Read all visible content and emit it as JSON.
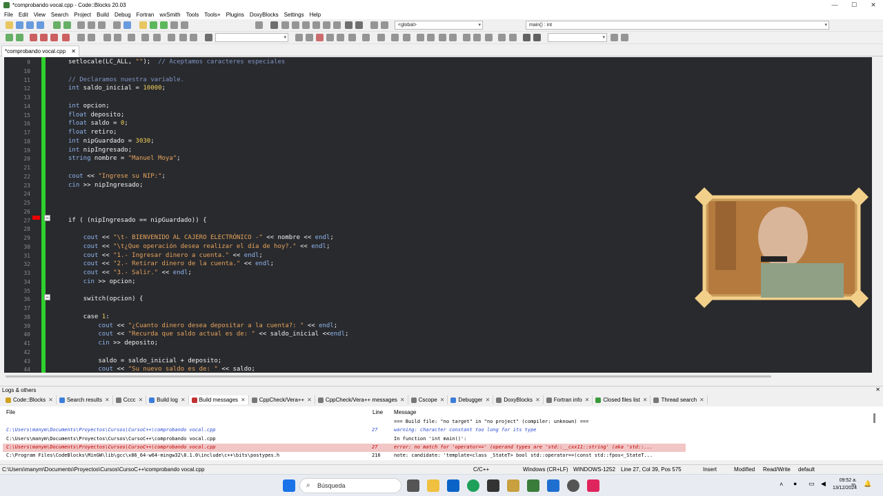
{
  "window": {
    "title": "*comprobando vocal.cpp - Code::Blocks 20.03",
    "controls": [
      "—",
      "☐",
      "✕"
    ]
  },
  "menu": [
    "File",
    "Edit",
    "View",
    "Search",
    "Project",
    "Build",
    "Debug",
    "Fortran",
    "wxSmith",
    "Tools",
    "Tools+",
    "Plugins",
    "DoxyBlocks",
    "Settings",
    "Help"
  ],
  "toolbar": {
    "scope_combo": "<global>",
    "function_combo": "main() : int"
  },
  "editor": {
    "tab_label": "*comprobando vocal.cpp",
    "tab_close": "✕",
    "fold_minus": "−",
    "lines": [
      {
        "n": "9",
        "t": [
          [
            "",
            "setlocale(LC_ALL, "
          ],
          [
            "str",
            "\"\""
          ],
          [
            "",
            ");  "
          ],
          [
            "com",
            "// Aceptamos caracteres especiales"
          ]
        ]
      },
      {
        "n": "10",
        "t": []
      },
      {
        "n": "11",
        "t": [
          [
            "com",
            "// Declaramos nuestra variable."
          ]
        ]
      },
      {
        "n": "12",
        "t": [
          [
            "type",
            "int"
          ],
          [
            "",
            " saldo_inicial = "
          ],
          [
            "num",
            "10000"
          ],
          [
            "",
            ";"
          ]
        ]
      },
      {
        "n": "13",
        "t": []
      },
      {
        "n": "14",
        "t": [
          [
            "type",
            "int"
          ],
          [
            "",
            " opcion;"
          ]
        ]
      },
      {
        "n": "15",
        "t": [
          [
            "type",
            "float"
          ],
          [
            "",
            " deposito;"
          ]
        ]
      },
      {
        "n": "16",
        "t": [
          [
            "type",
            "float"
          ],
          [
            "",
            " saldo = "
          ],
          [
            "num",
            "0"
          ],
          [
            "",
            ";"
          ]
        ]
      },
      {
        "n": "17",
        "t": [
          [
            "type",
            "float"
          ],
          [
            "",
            " retiro;"
          ]
        ]
      },
      {
        "n": "18",
        "t": [
          [
            "type",
            "int"
          ],
          [
            "",
            " nipGuardado = "
          ],
          [
            "num",
            "3030"
          ],
          [
            "",
            ";"
          ]
        ]
      },
      {
        "n": "19",
        "t": [
          [
            "type",
            "int"
          ],
          [
            "",
            " nipIngresado;"
          ]
        ]
      },
      {
        "n": "20",
        "t": [
          [
            "type",
            "string"
          ],
          [
            "",
            " nombre = "
          ],
          [
            "str",
            "\"Manuel Moya\""
          ],
          [
            "",
            ";"
          ]
        ]
      },
      {
        "n": "21",
        "t": []
      },
      {
        "n": "22",
        "t": [
          [
            "type",
            "cout"
          ],
          [
            "",
            " << "
          ],
          [
            "str",
            "\"Ingrese su NIP:\""
          ],
          [
            "",
            ";"
          ]
        ]
      },
      {
        "n": "23",
        "t": [
          [
            "type",
            "cin"
          ],
          [
            "",
            " >> nipIngresado;"
          ]
        ]
      },
      {
        "n": "24",
        "t": []
      },
      {
        "n": "25",
        "t": []
      },
      {
        "n": "26",
        "t": []
      },
      {
        "n": "27",
        "t": [
          [
            "",
            "if ( (nipIngresado == nipGuardado)) {"
          ]
        ]
      },
      {
        "n": "28",
        "t": []
      },
      {
        "n": "29",
        "t": [
          [
            "",
            "    "
          ],
          [
            "type",
            "cout"
          ],
          [
            "",
            " << "
          ],
          [
            "str",
            "\"\\t- BIENVENIDO AL CAJERO ELECTRÓNICO -\""
          ],
          [
            "",
            " << nombre << "
          ],
          [
            "type",
            "endl"
          ],
          [
            "",
            ";"
          ]
        ]
      },
      {
        "n": "30",
        "t": [
          [
            "",
            "    "
          ],
          [
            "type",
            "cout"
          ],
          [
            "",
            " << "
          ],
          [
            "str",
            "\"\\t¿Que operación desea realizar el día de hoy?.\""
          ],
          [
            "",
            " << "
          ],
          [
            "type",
            "endl"
          ],
          [
            "",
            ";"
          ]
        ]
      },
      {
        "n": "31",
        "t": [
          [
            "",
            "    "
          ],
          [
            "type",
            "cout"
          ],
          [
            "",
            " << "
          ],
          [
            "str",
            "\"1.- Ingresar dinero a cuenta.\""
          ],
          [
            "",
            " << "
          ],
          [
            "type",
            "endl"
          ],
          [
            "",
            ";"
          ]
        ]
      },
      {
        "n": "32",
        "t": [
          [
            "",
            "    "
          ],
          [
            "type",
            "cout"
          ],
          [
            "",
            " << "
          ],
          [
            "str",
            "\"2.- Retirar dinero de la cuenta.\""
          ],
          [
            "",
            " << "
          ],
          [
            "type",
            "endl"
          ],
          [
            "",
            ";"
          ]
        ]
      },
      {
        "n": "33",
        "t": [
          [
            "",
            "    "
          ],
          [
            "type",
            "cout"
          ],
          [
            "",
            " << "
          ],
          [
            "str",
            "\"3.- Salir.\""
          ],
          [
            "",
            " << "
          ],
          [
            "type",
            "endl"
          ],
          [
            "",
            ";"
          ]
        ]
      },
      {
        "n": "34",
        "t": [
          [
            "",
            "    "
          ],
          [
            "type",
            "cin"
          ],
          [
            "",
            " >> opcion;"
          ]
        ]
      },
      {
        "n": "35",
        "t": []
      },
      {
        "n": "36",
        "t": [
          [
            "",
            "    switch(opcion) {"
          ]
        ]
      },
      {
        "n": "37",
        "t": []
      },
      {
        "n": "38",
        "t": [
          [
            "",
            "    case "
          ],
          [
            "num",
            "1"
          ],
          [
            "",
            ":"
          ]
        ]
      },
      {
        "n": "39",
        "t": [
          [
            "",
            "        "
          ],
          [
            "type",
            "cout"
          ],
          [
            "",
            " << "
          ],
          [
            "str",
            "\"¿Cuanto dinero desea depositar a la cuenta?: \""
          ],
          [
            "",
            " << "
          ],
          [
            "type",
            "endl"
          ],
          [
            "",
            ";"
          ]
        ]
      },
      {
        "n": "40",
        "t": [
          [
            "",
            "        "
          ],
          [
            "type",
            "cout"
          ],
          [
            "",
            " << "
          ],
          [
            "str",
            "\"Recurda que saldo actual es de: \""
          ],
          [
            "",
            " << saldo_inicial <<"
          ],
          [
            "type",
            "endl"
          ],
          [
            "",
            ";"
          ]
        ]
      },
      {
        "n": "41",
        "t": [
          [
            "",
            "        "
          ],
          [
            "type",
            "cin"
          ],
          [
            "",
            " >> deposito;"
          ]
        ]
      },
      {
        "n": "42",
        "t": []
      },
      {
        "n": "43",
        "t": [
          [
            "",
            "        saldo = saldo_inicial + deposito;"
          ]
        ]
      },
      {
        "n": "44",
        "t": [
          [
            "",
            "        "
          ],
          [
            "type",
            "cout"
          ],
          [
            "",
            " << "
          ],
          [
            "str",
            "\"Su nuevo saldo es de: \""
          ],
          [
            "",
            " << saldo;"
          ]
        ]
      }
    ]
  },
  "logs": {
    "panel_title": "Logs & others",
    "tabs": [
      "Code::Blocks",
      "Search results",
      "Cccc",
      "Build log",
      "Build messages",
      "CppCheck/Vera++",
      "CppCheck/Vera++ messages",
      "Cscope",
      "Debugger",
      "DoxyBlocks",
      "Fortran info",
      "Closed files list",
      "Thread search"
    ],
    "columns": [
      "File",
      "Line",
      "Message"
    ],
    "rows": [
      {
        "file": "",
        "line": "",
        "msg": "=== Build file: \"no target\" in \"no project\" (compiler: unknown) ===",
        "style": "normal"
      },
      {
        "file": "C:\\Users\\manym\\Documents\\Proyectos\\Cursos\\CursoC++\\comprobando vocal.cpp",
        "line": "27",
        "msg": "warning: character constant too long for its type",
        "style": "warn"
      },
      {
        "file": "C:\\Users\\manym\\Documents\\Proyectos\\Cursos\\CursoC++\\comprobando vocal.cpp",
        "line": "",
        "msg": "In function 'int main()':",
        "style": "normal"
      },
      {
        "file": "C:\\Users\\manym\\Documents\\Proyectos\\Cursos\\CursoC++\\comprobando vocal.cpp",
        "line": "27",
        "msg": "error: no match for 'operator==' (operand types are 'std::__cxx11::string' (aka 'std::...",
        "style": "error"
      },
      {
        "file": "C:\\Program Files\\CodeBlocks\\MinGW\\lib\\gcc\\x86_64-w64-mingw32\\8.1.0\\include\\c++\\bits\\postypes.h",
        "line": "216",
        "msg": "note: candidate: 'template<class _StateT> bool std::operator==(const std::fpos<_StateT...",
        "style": "normal"
      }
    ]
  },
  "status": {
    "path": "C:\\Users\\manym\\Documents\\Proyectos\\Cursos\\CursoC++\\comprobando vocal.cpp",
    "lang": "C/C++",
    "eol": "Windows (CR+LF)",
    "enc": "WINDOWS-1252",
    "pos": "Line 27, Col 39, Pos 575",
    "mode": "Insert",
    "modified": "Modified",
    "rw": "Read/Write",
    "profile": "default"
  },
  "taskbar": {
    "search_placeholder": "Búsqueda",
    "time": "09:52 a. m.",
    "date": "13/12/2024"
  },
  "colors": {
    "editor_bg": "#292a2d",
    "change_bar": "#2ed12e",
    "breakpoint": "#e00000"
  }
}
